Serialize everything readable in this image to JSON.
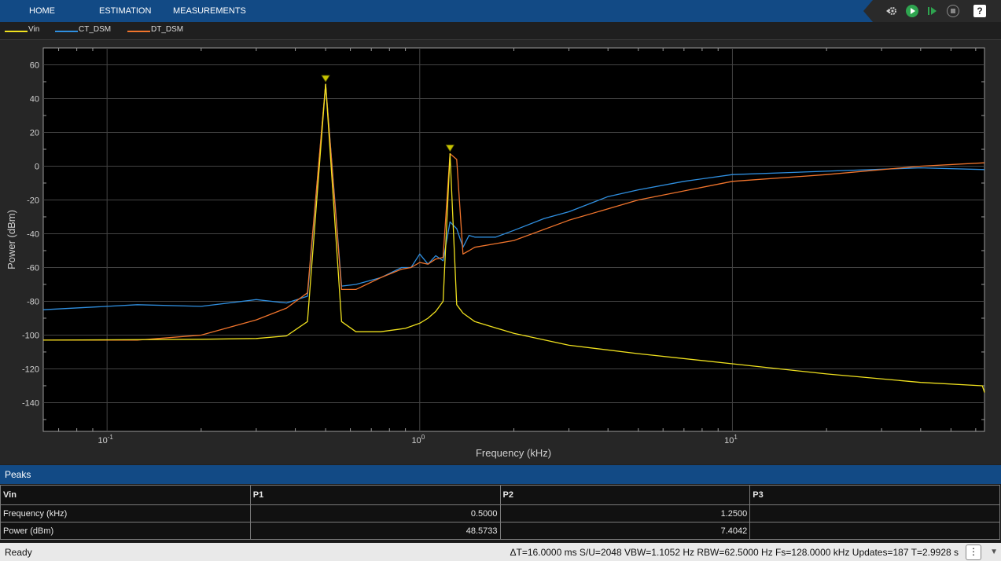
{
  "toolbar": {
    "tabs": [
      "HOME",
      "ESTIMATION",
      "MEASUREMENTS"
    ],
    "controls": [
      "settings-icon",
      "run-icon",
      "step-forward-icon",
      "stop-icon",
      "help-icon"
    ],
    "help_label": "?"
  },
  "colors": {
    "Vin": "#f0e11e",
    "CT_DSM": "#2f8fe0",
    "DT_DSM": "#f0742c",
    "toolbar": "#124a85",
    "marker": "#c8c400"
  },
  "chart_data": {
    "type": "line",
    "x_scale": "log",
    "xlabel": "Frequency (kHz)",
    "ylabel": "Power (dBm)",
    "xlim": [
      0.0625,
      64
    ],
    "ylim": [
      -157,
      70
    ],
    "x_tick_values": [
      0.1,
      1,
      10
    ],
    "x_tick_labels": [
      [
        "10",
        "-1"
      ],
      [
        "10",
        "0"
      ],
      [
        "10",
        "1"
      ]
    ],
    "y_ticks": [
      60,
      40,
      20,
      0,
      -20,
      -40,
      -60,
      -80,
      -100,
      -120,
      -140
    ],
    "grid": true,
    "legend_position": "top-left",
    "series": [
      {
        "name": "Vin",
        "x": [
          0.0625,
          0.1,
          0.2,
          0.3,
          0.375,
          0.4375,
          0.5,
          0.5625,
          0.625,
          0.75,
          0.9,
          1.0,
          1.0625,
          1.125,
          1.1875,
          1.25,
          1.3125,
          1.375,
          1.5,
          2.0,
          3.0,
          5.0,
          10.0,
          20.0,
          40.0,
          63.0,
          64.0
        ],
        "y": [
          -103,
          -102.8,
          -102.5,
          -102,
          -100.5,
          -92,
          48.57,
          -92,
          -98,
          -98,
          -96,
          -93,
          -90,
          -86,
          -80,
          7.4,
          -82,
          -87,
          -92,
          -99,
          -106,
          -111,
          -117,
          -123,
          -128,
          -130,
          -134
        ]
      },
      {
        "name": "CT_DSM",
        "x": [
          0.0625,
          0.125,
          0.2,
          0.3,
          0.375,
          0.4375,
          0.5,
          0.5625,
          0.625,
          0.75,
          0.875,
          0.9375,
          1.0,
          1.0625,
          1.125,
          1.1875,
          1.25,
          1.3125,
          1.375,
          1.4375,
          1.5,
          1.75,
          2.0,
          2.5,
          3.0,
          4.0,
          5.0,
          7.0,
          10.0,
          20.0,
          40.0,
          64.0
        ],
        "y": [
          -85,
          -82,
          -83,
          -79,
          -81,
          -77,
          48.57,
          -71,
          -70,
          -66,
          -60,
          -60,
          -52,
          -58,
          -53,
          -56,
          -33,
          -37,
          -48,
          -41,
          -42,
          -42,
          -38,
          -31,
          -27,
          -18,
          -14,
          -9,
          -5,
          -3,
          -1,
          -2
        ]
      },
      {
        "name": "DT_DSM",
        "x": [
          0.0625,
          0.125,
          0.2,
          0.3,
          0.375,
          0.4375,
          0.5,
          0.5625,
          0.625,
          0.75,
          0.875,
          0.9375,
          1.0,
          1.0625,
          1.125,
          1.1875,
          1.25,
          1.3125,
          1.375,
          1.4375,
          1.5,
          2.0,
          3.0,
          5.0,
          10.0,
          20.0,
          40.0,
          64.0
        ],
        "y": [
          -103,
          -103,
          -100,
          -91,
          -84,
          -75,
          48.57,
          -73,
          -73,
          -66,
          -61,
          -60,
          -57,
          -58,
          -55,
          -54,
          7.4,
          4,
          -52,
          -50,
          -48,
          -44,
          -32,
          -20,
          -9,
          -5,
          0,
          2
        ]
      }
    ],
    "peak_markers": [
      {
        "x": 0.5,
        "y": 48.5733
      },
      {
        "x": 1.25,
        "y": 7.4042
      }
    ]
  },
  "peaks": {
    "title": "Peaks",
    "columns": [
      "Vin",
      "P1",
      "P2",
      "P3"
    ],
    "rows": [
      {
        "label": "Frequency (kHz)",
        "values": [
          "0.5000",
          "1.2500",
          ""
        ]
      },
      {
        "label": "Power (dBm)",
        "values": [
          "48.5733",
          "7.4042",
          ""
        ]
      }
    ]
  },
  "status": {
    "ready": "Ready",
    "info": "ΔT=16.0000 ms  S/U=2048  VBW=1.1052 Hz  RBW=62.5000 Hz  Fs=128.0000 kHz  Updates=187  T=2.9928 s",
    "more": "⋮",
    "corner": "▼"
  }
}
